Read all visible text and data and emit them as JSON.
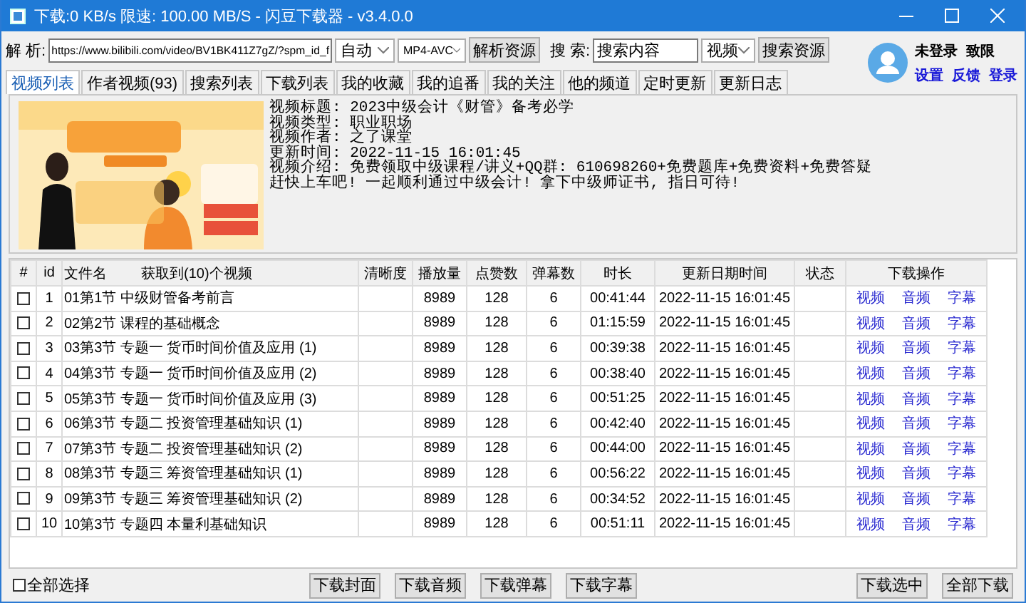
{
  "window": {
    "title": "下载:0 KB/s 限速: 100.00 MB/S - 闪豆下载器 - v3.4.0.0"
  },
  "toolbar": {
    "parse_label": "解 析:",
    "url": "https://www.bilibili.com/video/BV1BK411Z7gZ/?spm_id_f",
    "quality": "自动",
    "codec": "MP4-AVC",
    "parse_button": "解析资源",
    "search_label": "搜 索:",
    "search_value": "搜索内容",
    "search_type": "视频",
    "search_button": "搜索资源"
  },
  "user": {
    "status": "未登录",
    "permission": "致限",
    "links": [
      "设置",
      "反馈",
      "登录"
    ]
  },
  "tabs": [
    {
      "label": "视频列表",
      "selected": true
    },
    {
      "label": "作者视频(93)",
      "selected": false
    },
    {
      "label": "搜索列表",
      "selected": false
    },
    {
      "label": "下载列表",
      "selected": false
    },
    {
      "label": "我的收藏",
      "selected": false
    },
    {
      "label": "我的追番",
      "selected": false
    },
    {
      "label": "我的关注",
      "selected": false
    },
    {
      "label": "他的频道",
      "selected": false
    },
    {
      "label": "定时更新",
      "selected": false
    },
    {
      "label": "更新日志",
      "selected": false
    }
  ],
  "info": {
    "lines": [
      "视频标题: 2023中级会计《财管》备考必学",
      "视频类型: 职业职场",
      "视频作者: 之了课堂",
      "更新时间: 2022-11-15 16:01:45",
      "视频介绍: 免费领取中级课程/讲义+QQ群: 610698260+免费题库+免费资料+免费答疑",
      "赶快上车吧! 一起顺利通过中级会计! 拿下中级师证书, 指日可待!"
    ]
  },
  "table": {
    "columns": [
      "#",
      "id",
      "文件名",
      "获取到(10)个视频",
      "清晰度",
      "播放量",
      "点赞数",
      "弹幕数",
      "时长",
      "更新日期时间",
      "状态",
      "下载操作"
    ],
    "rows": [
      {
        "checked": false,
        "id": "1",
        "name": "01第1节 中级财管备考前言",
        "plays": "8989",
        "likes": "128",
        "danmaku": "6",
        "duration": "00:41:44",
        "updated": "2022-11-15 16:01:45",
        "actions": [
          "视频",
          "音频",
          "字幕"
        ]
      },
      {
        "checked": false,
        "id": "2",
        "name": "02第2节 课程的基础概念",
        "plays": "8989",
        "likes": "128",
        "danmaku": "6",
        "duration": "01:15:59",
        "updated": "2022-11-15 16:01:45",
        "actions": [
          "视频",
          "音频",
          "字幕"
        ]
      },
      {
        "checked": false,
        "id": "3",
        "name": "03第3节 专题一 货币时间价值及应用 (1)",
        "plays": "8989",
        "likes": "128",
        "danmaku": "6",
        "duration": "00:39:38",
        "updated": "2022-11-15 16:01:45",
        "actions": [
          "视频",
          "音频",
          "字幕"
        ]
      },
      {
        "checked": false,
        "id": "4",
        "name": "04第3节 专题一 货币时间价值及应用 (2)",
        "plays": "8989",
        "likes": "128",
        "danmaku": "6",
        "duration": "00:38:40",
        "updated": "2022-11-15 16:01:45",
        "actions": [
          "视频",
          "音频",
          "字幕"
        ]
      },
      {
        "checked": false,
        "id": "5",
        "name": "05第3节 专题一 货币时间价值及应用 (3)",
        "plays": "8989",
        "likes": "128",
        "danmaku": "6",
        "duration": "00:51:25",
        "updated": "2022-11-15 16:01:45",
        "actions": [
          "视频",
          "音频",
          "字幕"
        ]
      },
      {
        "checked": false,
        "id": "6",
        "name": "06第3节 专题二 投资管理基础知识 (1)",
        "plays": "8989",
        "likes": "128",
        "danmaku": "6",
        "duration": "00:42:40",
        "updated": "2022-11-15 16:01:45",
        "actions": [
          "视频",
          "音频",
          "字幕"
        ]
      },
      {
        "checked": false,
        "id": "7",
        "name": "07第3节 专题二 投资管理基础知识 (2)",
        "plays": "8989",
        "likes": "128",
        "danmaku": "6",
        "duration": "00:44:00",
        "updated": "2022-11-15 16:01:45",
        "actions": [
          "视频",
          "音频",
          "字幕"
        ]
      },
      {
        "checked": false,
        "id": "8",
        "name": "08第3节 专题三 筹资管理基础知识 (1)",
        "plays": "8989",
        "likes": "128",
        "danmaku": "6",
        "duration": "00:56:22",
        "updated": "2022-11-15 16:01:45",
        "actions": [
          "视频",
          "音频",
          "字幕"
        ]
      },
      {
        "checked": false,
        "id": "9",
        "name": "09第3节 专题三 筹资管理基础知识 (2)",
        "plays": "8989",
        "likes": "128",
        "danmaku": "6",
        "duration": "00:34:52",
        "updated": "2022-11-15 16:01:45",
        "actions": [
          "视频",
          "音频",
          "字幕"
        ]
      },
      {
        "checked": false,
        "id": "10",
        "name": "10第3节 专题四 本量利基础知识",
        "plays": "8989",
        "likes": "128",
        "danmaku": "6",
        "duration": "00:51:11",
        "updated": "2022-11-15 16:01:45",
        "actions": [
          "视频",
          "音频",
          "字幕"
        ]
      }
    ]
  },
  "footer": {
    "select_all": {
      "label": "全部选择",
      "checked": false
    },
    "buttons": [
      "下载封面",
      "下载音频",
      "下载弹幕",
      "下载字幕"
    ],
    "right_buttons": [
      "下载选中",
      "全部下载"
    ]
  }
}
